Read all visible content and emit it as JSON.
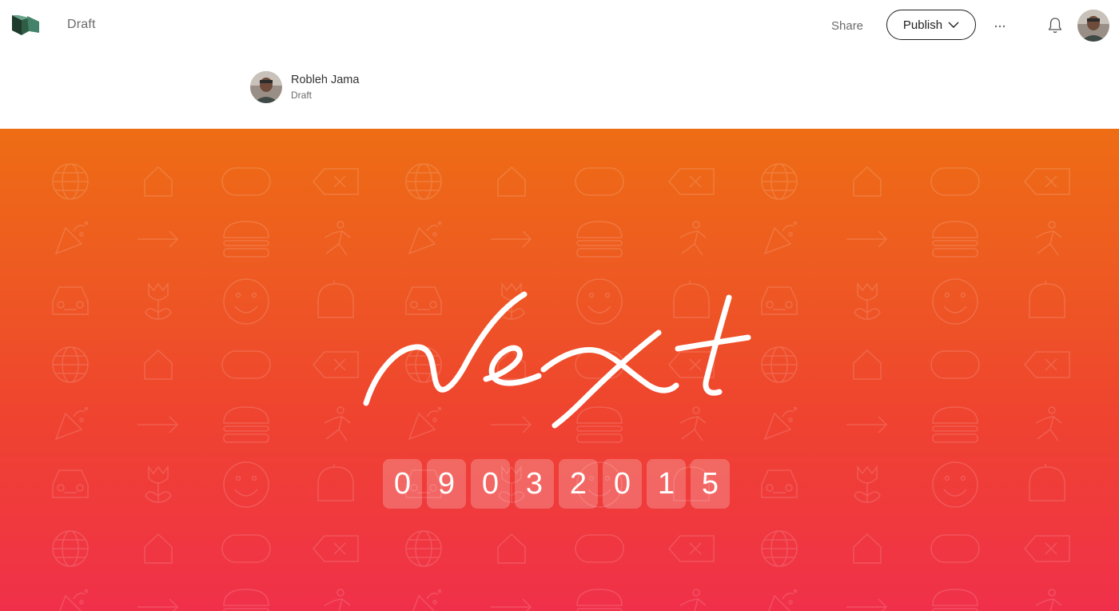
{
  "header": {
    "logo_icon": "medium-logo-icon",
    "status_label": "Draft",
    "share_label": "Share",
    "publish_label": "Publish",
    "more_icon": "more-horizontal-icon",
    "notifications_icon": "bell-icon",
    "avatar_icon": "user-avatar"
  },
  "byline": {
    "author_name": "Robleh Jama",
    "status": "Draft"
  },
  "hero": {
    "wordmark": "next",
    "digits": [
      "0",
      "9",
      "0",
      "3",
      "2",
      "0",
      "1",
      "5"
    ],
    "gradient_top": "#ee6d14",
    "gradient_bottom": "#f0304a",
    "pattern_icons": [
      "globe-icon",
      "home-icon",
      "emoji-symbols-icon",
      "delete-key-icon",
      "party-popper-icon",
      "arrow-right-icon",
      "burger-icon",
      "runner-icon",
      "car-icon",
      "flower-icon",
      "smiley-icon",
      "bell-icon"
    ]
  }
}
